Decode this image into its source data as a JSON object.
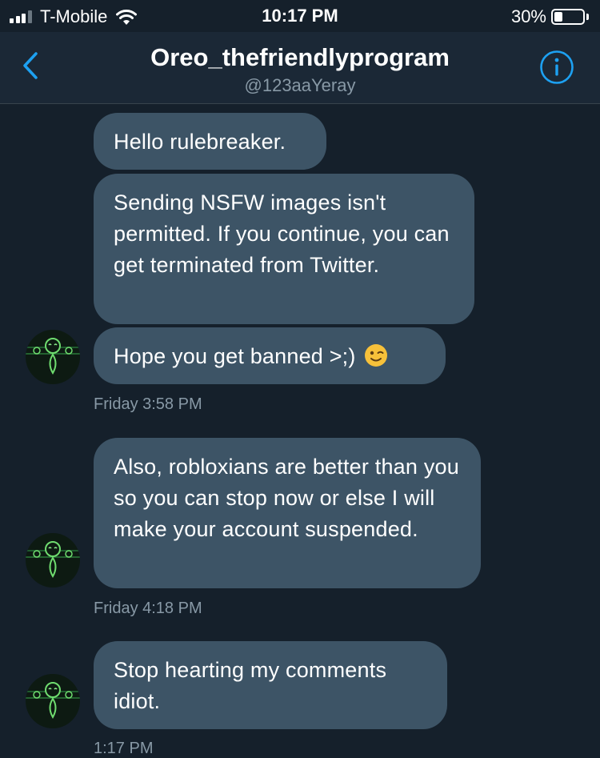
{
  "status_bar": {
    "carrier": "T-Mobile",
    "time": "10:17 PM",
    "battery_percent": "30%",
    "battery_level": 0.3,
    "signal_bars": 3
  },
  "header": {
    "name": "Oreo_thefriendlyprogram",
    "handle": "@123aaYeray",
    "back_icon": "chevron-left-icon",
    "info_icon": "info-circle-icon"
  },
  "messages": [
    {
      "text": "Hello rulebreaker."
    },
    {
      "text": "Sending NSFW images isn't permitted. If you continue, you can get terminated from Twitter."
    },
    {
      "text": "Hope you get banned >;)",
      "emoji": "winking-face-emoji"
    },
    {
      "text": "Also, robloxians are better than you so you can stop now or else I will make your account suspended."
    },
    {
      "text": "Stop hearting my comments idiot."
    }
  ],
  "timestamps": [
    "Friday 3:58 PM",
    "Friday 4:18 PM",
    "1:17 PM"
  ],
  "colors": {
    "background": "#15202b",
    "header": "#1b2836",
    "bubble": "#3d5466",
    "accent": "#1da1f2",
    "muted_text": "#8899a6"
  }
}
